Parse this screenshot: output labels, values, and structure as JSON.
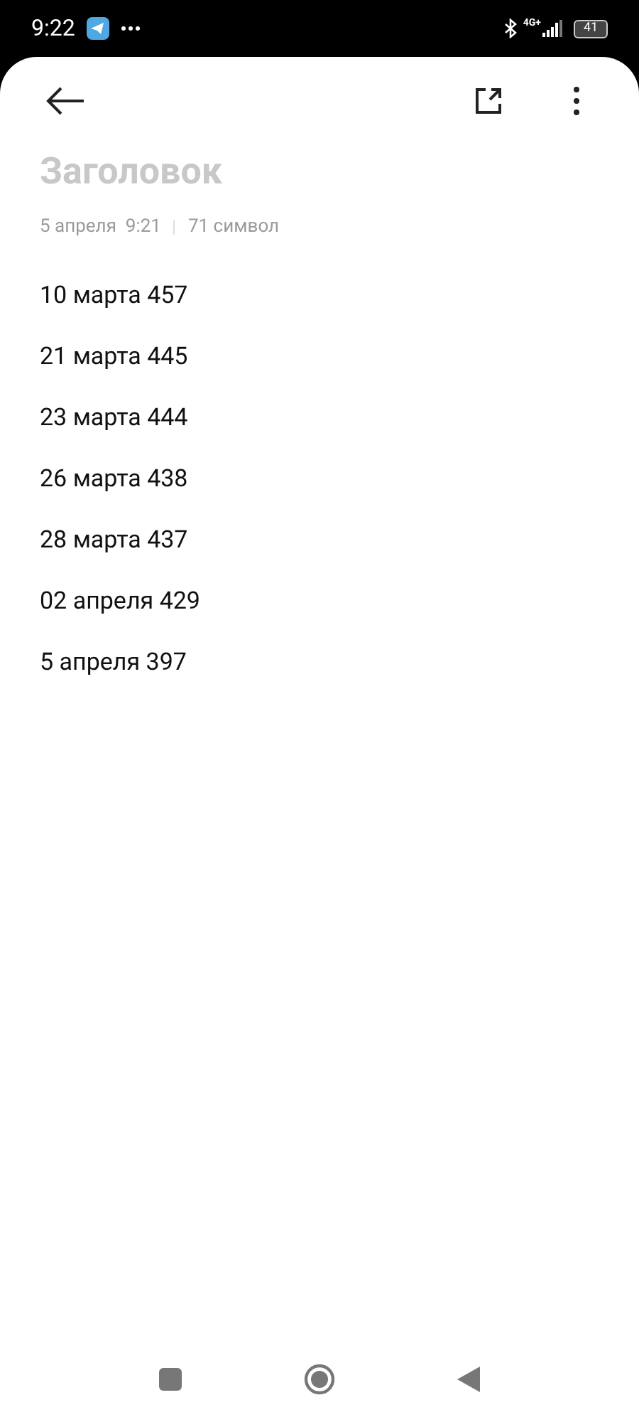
{
  "status_bar": {
    "time": "9:22",
    "network": "4G+",
    "battery": "41"
  },
  "note": {
    "title_placeholder": "Заголовок",
    "date": "5 апреля  9:21",
    "char_count": "71 символ",
    "lines": [
      "10 марта 457",
      "21 марта 445",
      "23 марта 444",
      "26 марта 438",
      "28 марта 437",
      "02 апреля 429",
      "5 апреля 397"
    ]
  }
}
